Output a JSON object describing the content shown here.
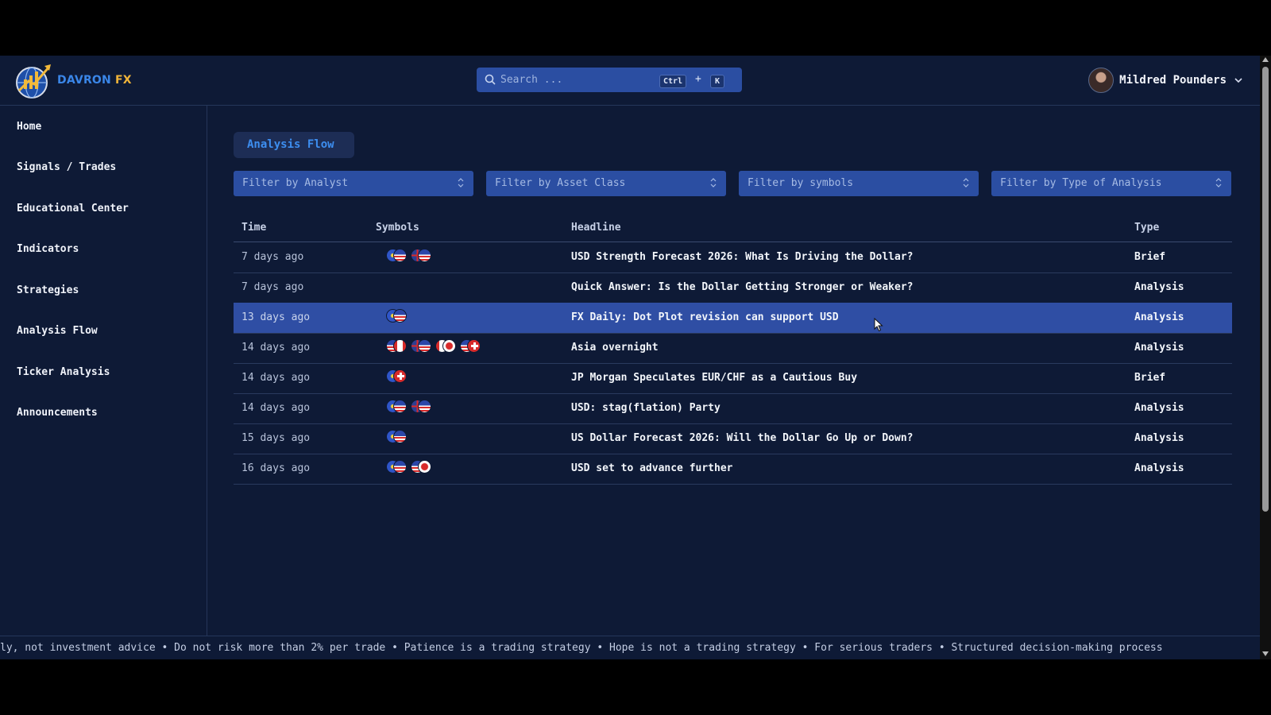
{
  "brand": {
    "name_part1": "DAVRON",
    "name_part2": "FX"
  },
  "search": {
    "placeholder": "Search ...",
    "shortcut_key1": "Ctrl",
    "shortcut_plus": "+",
    "shortcut_key2": "K"
  },
  "user": {
    "name": "Mildred Pounders"
  },
  "sidebar": {
    "items": [
      {
        "label": "Home"
      },
      {
        "label": "Signals / Trades"
      },
      {
        "label": "Educational Center"
      },
      {
        "label": "Indicators"
      },
      {
        "label": "Strategies"
      },
      {
        "label": "Analysis Flow"
      },
      {
        "label": "Ticker Analysis"
      },
      {
        "label": "Announcements"
      }
    ]
  },
  "main": {
    "title": "Analysis Flow",
    "filters": [
      {
        "label": "Filter by Analyst"
      },
      {
        "label": "Filter by Asset Class"
      },
      {
        "label": "Filter by symbols"
      },
      {
        "label": "Filter by Type of Analysis"
      }
    ],
    "table": {
      "columns": {
        "time": "Time",
        "symbols": "Symbols",
        "headline": "Headline",
        "type": "Type"
      },
      "rows": [
        {
          "time": "7 days ago",
          "headline": "USD Strength Forecast 2026: What Is Driving the Dollar?",
          "type": "Brief",
          "symbols": [
            [
              "eu",
              "us"
            ],
            [
              "gb",
              "us"
            ]
          ],
          "selected": false
        },
        {
          "time": "7 days ago",
          "headline": "Quick Answer: Is the Dollar Getting Stronger or Weaker?",
          "type": "Analysis",
          "symbols": [],
          "selected": false
        },
        {
          "time": "13 days ago",
          "headline": "FX Daily: Dot Plot revision can support USD",
          "type": "Analysis",
          "symbols": [
            [
              "eu",
              "us"
            ]
          ],
          "selected": true
        },
        {
          "time": "14 days ago",
          "headline": "Asia overnight",
          "type": "Analysis",
          "symbols": [
            [
              "us",
              "ca"
            ],
            [
              "gb",
              "us"
            ],
            [
              "ca",
              "jp"
            ],
            [
              "us",
              "ch"
            ]
          ],
          "selected": false
        },
        {
          "time": "14 days ago",
          "headline": "JP Morgan Speculates EUR/CHF as a Cautious Buy",
          "type": "Brief",
          "symbols": [
            [
              "eu",
              "ch"
            ]
          ],
          "selected": false
        },
        {
          "time": "14 days ago",
          "headline": "USD: stag(flation) Party",
          "type": "Analysis",
          "symbols": [
            [
              "eu",
              "us"
            ],
            [
              "gb",
              "us"
            ]
          ],
          "selected": false
        },
        {
          "time": "15 days ago",
          "headline": "US Dollar Forecast 2026: Will the Dollar Go Up or Down?",
          "type": "Analysis",
          "symbols": [
            [
              "eu",
              "us"
            ]
          ],
          "selected": false
        },
        {
          "time": "16 days ago",
          "headline": "USD set to advance further",
          "type": "Analysis",
          "symbols": [
            [
              "eu",
              "us"
            ],
            [
              "us",
              "jp"
            ]
          ],
          "selected": false
        }
      ]
    }
  },
  "ticker": {
    "text": "ly, not investment advice • Do not risk more than 2% per trade • Patience is a trading strategy • Hope is not a trading strategy • For serious traders • Structured decision-making process"
  },
  "colors": {
    "background": "#0e1a36",
    "accent": "#3d8ef0",
    "selected_row": "#2f4ea4",
    "filter_bg": "#2b4ea2"
  }
}
